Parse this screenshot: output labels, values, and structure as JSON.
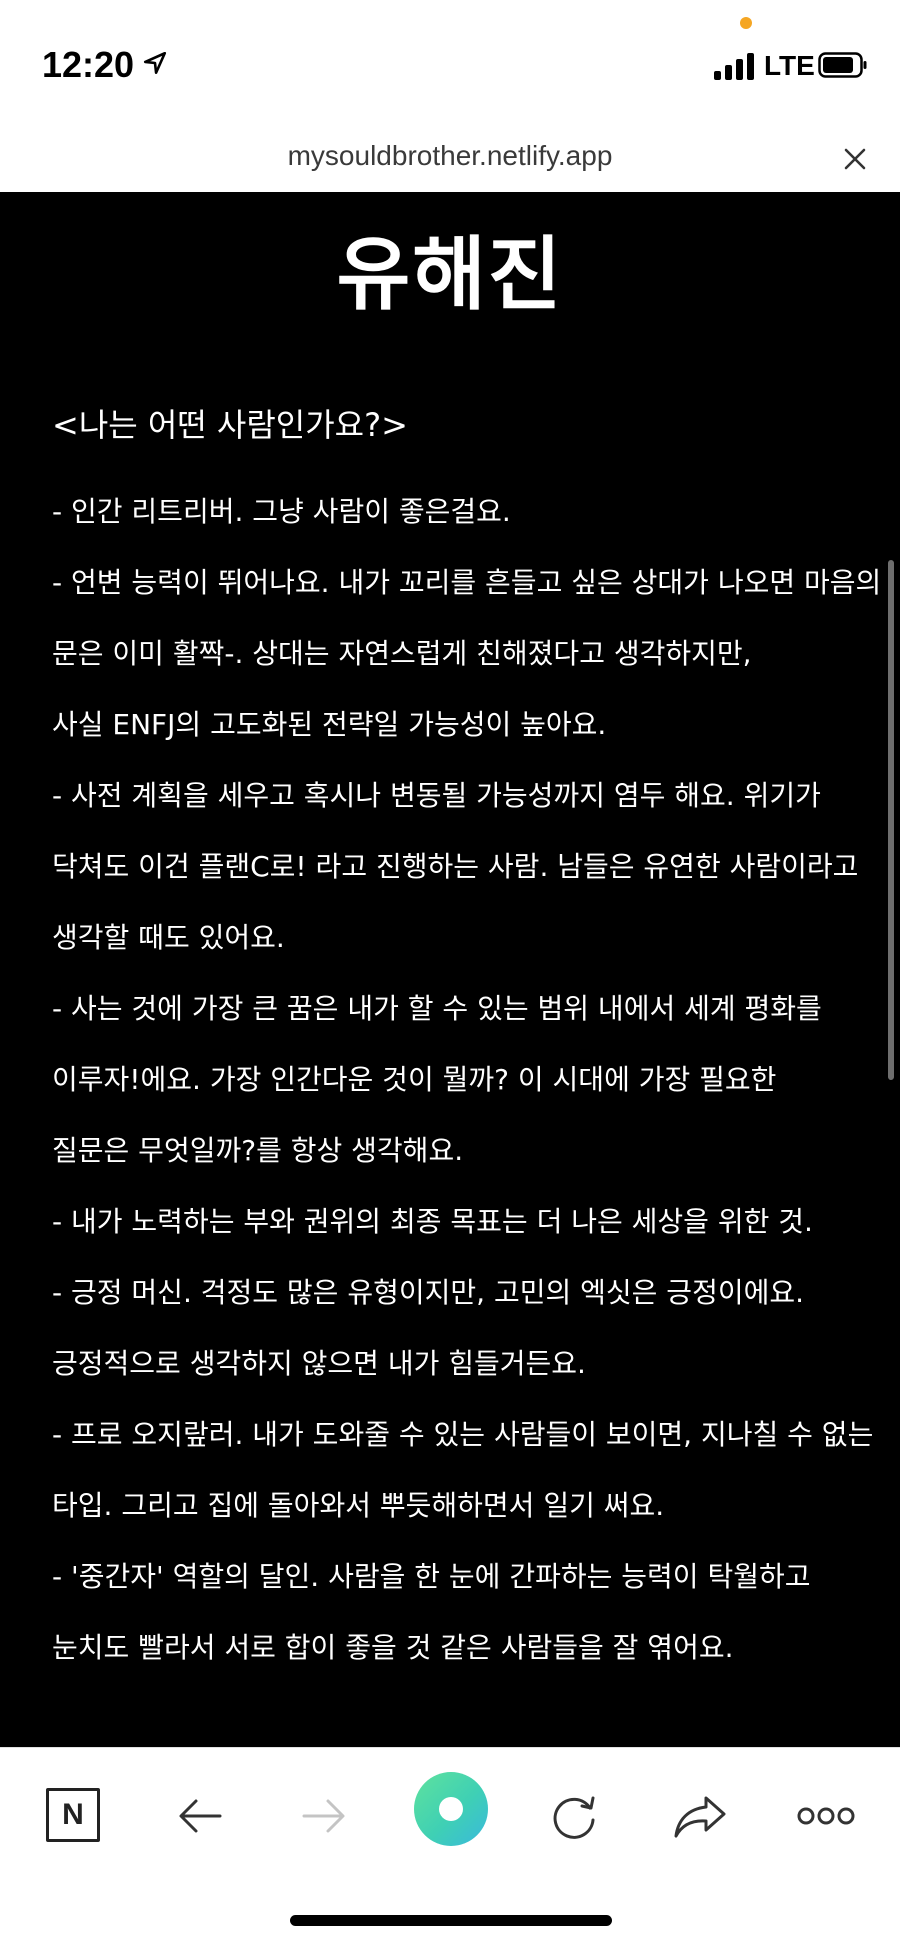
{
  "status_bar": {
    "time": "12:20",
    "network": "LTE",
    "camera_dot_color": "#f5a623"
  },
  "url_bar": {
    "url": "mysouldbrother.netlify.app"
  },
  "page": {
    "title": "유해진",
    "heading": "<나는 어떤 사람인가요?>",
    "lines": [
      "- 인간 리트리버. 그냥 사람이 좋은걸요.",
      "- 언변 능력이 뛰어나요. 내가 꼬리를 흔들고 싶은 상대가 나오면 마음의",
      "문은 이미 활짝-. 상대는 자연스럽게 친해졌다고 생각하지만,",
      "사실 ENFJ의 고도화된 전략일 가능성이 높아요.",
      "- 사전 계획을 세우고 혹시나 변동될 가능성까지 염두 해요. 위기가",
      "닥쳐도 이건 플랜C로! 라고 진행하는 사람. 남들은 유연한 사람이라고",
      " 생각할 때도 있어요.",
      "- 사는 것에 가장 큰 꿈은 내가 할 수 있는 범위 내에서 세계 평화를",
      "이루자!에요. 가장 인간다운 것이 뭘까? 이 시대에 가장 필요한",
      "질문은 무엇일까?를 항상 생각해요.",
      "- 내가 노력하는 부와 권위의 최종 목표는 더 나은 세상을 위한 것.",
      "- 긍정 머신. 걱정도 많은 유형이지만, 고민의 엑싯은 긍정이에요.",
      "긍정적으로 생각하지 않으면 내가 힘들거든요.",
      "- 프로 오지랖러. 내가 도와줄 수 있는 사람들이 보이면, 지나칠 수 없는",
      "타입. 그리고 집에 돌아와서 뿌듯해하면서 일기 써요.",
      "- '중간자' 역할의 달인. 사람을 한 눈에 간파하는 능력이 탁월하고",
      "눈치도 빨라서 서로 합이 좋을 것 같은 사람들을 잘 엮어요."
    ],
    "background_color": "#000000",
    "text_color": "#ffffff"
  },
  "toolbar": {
    "n_label": "N",
    "accent_gradient": [
      "#5fe29d",
      "#39b9dd"
    ]
  }
}
